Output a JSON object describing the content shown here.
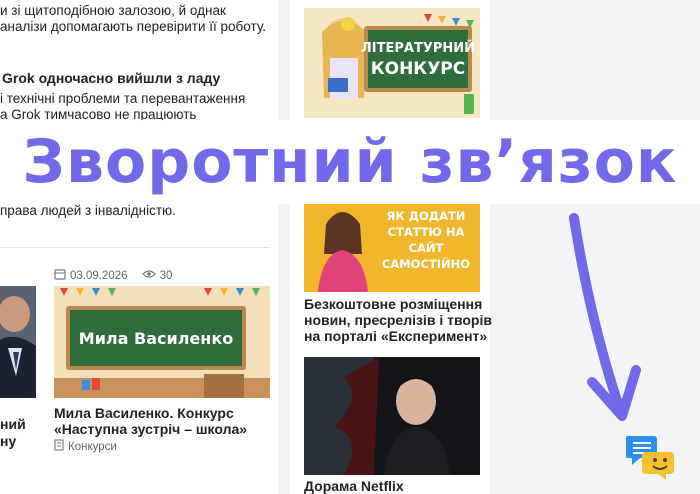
{
  "left_column": {
    "lines": [
      "и зі щитоподібною залозою, й однак",
      "аналізи допомагають перевірити її роботу.",
      "Grok одночасно вийшли з ладу",
      "і технічні проблеми та перевантаження",
      "а Grok тимчасово не працюють",
      "права людей з інвалідністю."
    ],
    "card_left_title": [
      "ний",
      "ну"
    ],
    "card": {
      "date": "03.09.2026",
      "views": "30",
      "board_text": "Мила Василенко",
      "title_line1": "Мила Василенко. Конкурс",
      "title_line2": "«Наступна зустріч – школа»",
      "category": "Конкурси"
    }
  },
  "middle_column": {
    "banner1_text": [
      "ЛІТЕРАТУРНИЙ",
      "КОНКУРС"
    ],
    "banner2_text": [
      "ЯК ДОДАТИ",
      "СТАТТЮ НА САЙТ",
      "САМОСТІЙНО"
    ],
    "article_title": [
      "Безкоштовне розміщення",
      "новин, пресрелізів і творів",
      "на порталі «Експеримент»"
    ],
    "last_title": "Дорама Netflix"
  },
  "overlay": {
    "title": "Зворотний зв’язок"
  },
  "colors": {
    "accent": "#7268ea",
    "board": "#2f6d3c",
    "banner_yellow": "#f2b62c"
  },
  "icons": [
    "calendar-icon",
    "eye-icon",
    "document-icon",
    "chat-icon",
    "arrow-icon"
  ]
}
